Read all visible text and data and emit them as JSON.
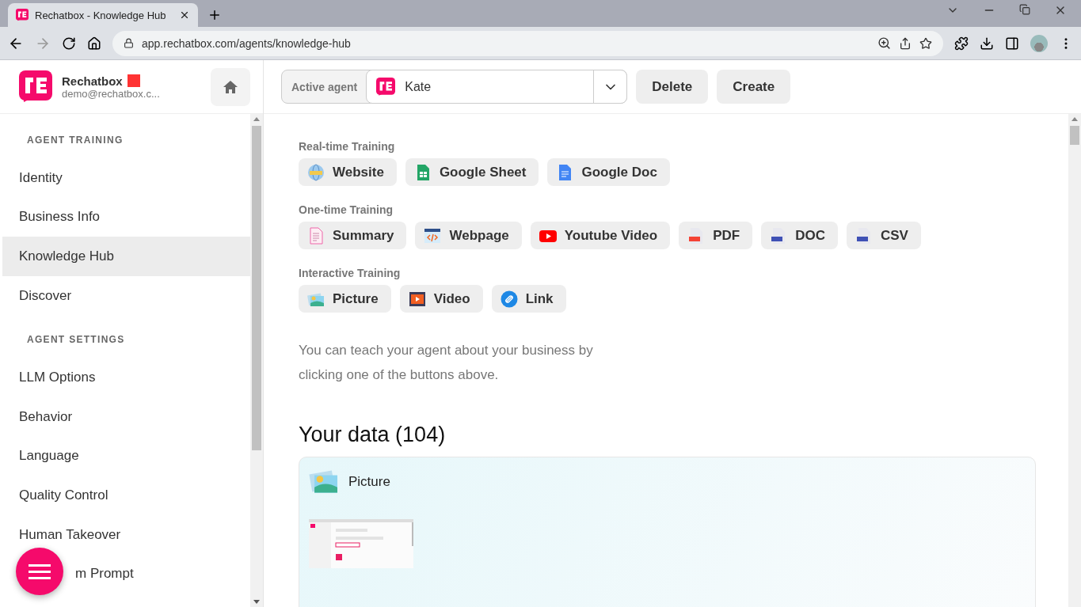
{
  "browser": {
    "tab_title": "Rechatbox - Knowledge Hub",
    "url": "app.rechatbox.com/agents/knowledge-hub"
  },
  "sidebar": {
    "brand": "Rechatbox",
    "email": "demo@rechatbox.c...",
    "sections": [
      {
        "heading": "AGENT TRAINING",
        "items": [
          {
            "label": "Identity",
            "selected": false
          },
          {
            "label": "Business Info",
            "selected": false
          },
          {
            "label": "Knowledge Hub",
            "selected": true
          },
          {
            "label": "Discover",
            "selected": false
          }
        ]
      },
      {
        "heading": "AGENT SETTINGS",
        "items": [
          {
            "label": "LLM Options",
            "selected": false
          },
          {
            "label": "Behavior",
            "selected": false
          },
          {
            "label": "Language",
            "selected": false
          },
          {
            "label": "Quality Control",
            "selected": false
          },
          {
            "label": "Human Takeover",
            "selected": false
          },
          {
            "label": "m Prompt",
            "selected": false
          }
        ]
      }
    ]
  },
  "header": {
    "agent_label": "Active agent",
    "agent": "Kate",
    "buttons": [
      "Delete",
      "Create"
    ]
  },
  "training_groups": [
    {
      "title": "Real-time Training",
      "buttons": [
        {
          "label": "Website",
          "kind": "globe"
        },
        {
          "label": "Google Sheet",
          "kind": "sheet"
        },
        {
          "label": "Google Doc",
          "kind": "doc"
        }
      ]
    },
    {
      "title": "One-time Training",
      "buttons": [
        {
          "label": "Summary",
          "kind": "summary"
        },
        {
          "label": "Webpage",
          "kind": "code"
        },
        {
          "label": "Youtube Video",
          "kind": "youtube"
        },
        {
          "label": "PDF",
          "kind": "pdf"
        },
        {
          "label": "DOC",
          "kind": "docx"
        },
        {
          "label": "CSV",
          "kind": "csv"
        }
      ]
    },
    {
      "title": "Interactive Training",
      "buttons": [
        {
          "label": "Picture",
          "kind": "picture"
        },
        {
          "label": "Video",
          "kind": "film"
        },
        {
          "label": "Link",
          "kind": "link"
        }
      ]
    }
  ],
  "hint": "You can teach your agent about your business by clicking one of the buttons above.",
  "data_title": "Your data (104)",
  "card": {
    "title": "Picture",
    "kind": "picture"
  }
}
